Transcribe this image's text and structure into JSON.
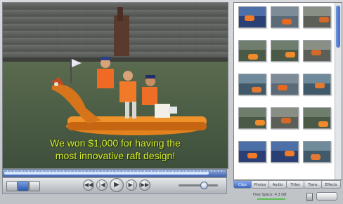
{
  "viewer": {
    "caption_line1": "We won $1,000 for having the",
    "caption_line2": "most innovative raft design!"
  },
  "scrubber": {
    "progress_fraction": 0.92
  },
  "controls": {
    "view_mode_icons": [
      "single-view-icon",
      "grid-view-icon",
      "list-view-icon"
    ],
    "transport_icons": [
      "rewind-icon",
      "previous-icon",
      "play-icon",
      "next-icon",
      "fast-forward-icon"
    ],
    "volume_level": 0.62
  },
  "clips": [
    {
      "label": "",
      "scene": "blue"
    },
    {
      "label": "",
      "scene": "boats"
    },
    {
      "label": "",
      "scene": "crowd"
    },
    {
      "label": "",
      "scene": "raft"
    },
    {
      "label": "",
      "scene": "raft"
    },
    {
      "label": "",
      "scene": "crowd"
    },
    {
      "label": "",
      "scene": "water"
    },
    {
      "label": "",
      "scene": "boats"
    },
    {
      "label": "",
      "scene": "water"
    },
    {
      "label": "",
      "scene": "raft"
    },
    {
      "label": "",
      "scene": "crowd"
    },
    {
      "label": "",
      "scene": "raft"
    },
    {
      "label": "",
      "scene": "blue"
    },
    {
      "label": "",
      "scene": "blue"
    },
    {
      "label": "",
      "scene": "water"
    }
  ],
  "tabs": [
    {
      "label": "Clips",
      "active": true
    },
    {
      "label": "Photos",
      "active": false
    },
    {
      "label": "Audio",
      "active": false
    },
    {
      "label": "Titles",
      "active": false
    },
    {
      "label": "Trans",
      "active": false
    },
    {
      "label": "Effects",
      "active": false
    }
  ],
  "status": {
    "text": "Free Space: 4.3 GB",
    "trash_icon": "trash-icon"
  },
  "colors": {
    "caption": "#d9ee2f",
    "accent_blue": "#3d67c0"
  }
}
